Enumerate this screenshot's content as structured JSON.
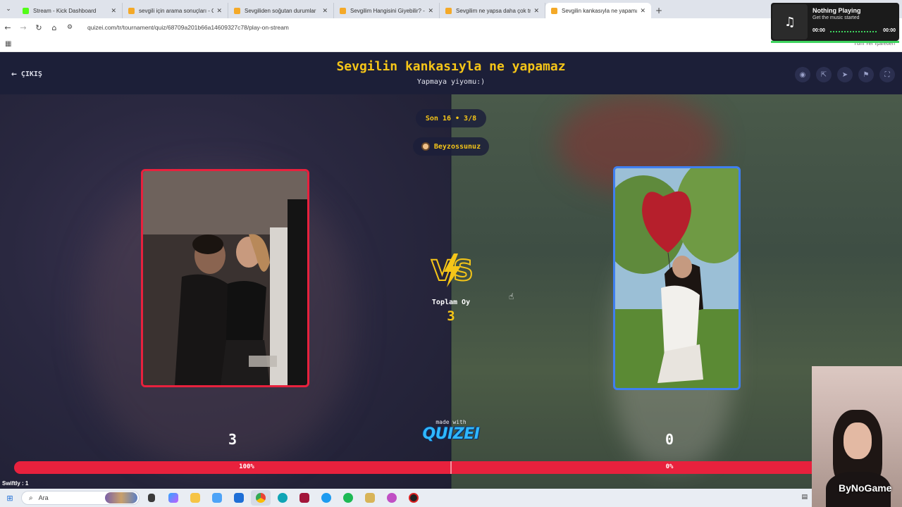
{
  "browser": {
    "tabs": [
      {
        "label": "Stream - Kick Dashboard",
        "color": "#53fc18",
        "active": false
      },
      {
        "label": "sevgili için arama sonuçları - Qu",
        "color": "#f4a928",
        "active": false
      },
      {
        "label": "Sevgiliden soğutan durumlar",
        "color": "#f4a928",
        "active": false
      },
      {
        "label": "Sevgilim Hangisini Giyebilir? - T",
        "color": "#f4a928",
        "active": false
      },
      {
        "label": "Sevgilim ne yapsa daha çok tri",
        "color": "#f4a928",
        "active": false
      },
      {
        "label": "Sevgilin kankasıyla ne yapamaz",
        "color": "#f4a928",
        "active": true
      }
    ],
    "url": "quizei.com/tr/tournament/quiz/68709a201b66a14609327c78/play-on-stream",
    "all_bookmarks": "Tüm Yer İşaretleri"
  },
  "header": {
    "back_label": "ÇIKIŞ",
    "title": "Sevgilin kankasıyla ne yapamaz",
    "subtitle": "Yapmaya yiyomu:)",
    "icons": [
      "eye-icon",
      "share-icon",
      "send-icon",
      "flag-icon",
      "fullscreen-icon"
    ]
  },
  "match": {
    "round": "Son 16 • 3/8",
    "streamer": "Beyzossunuz",
    "total_label": "Toplam Oy",
    "total_value": "3",
    "left": {
      "votes": "3",
      "percent_label": "100%",
      "fraction": 1.0
    },
    "right": {
      "votes": "0",
      "percent_label": "0%",
      "fraction": 0.0
    }
  },
  "branding": {
    "made_with": "made with",
    "logo": "QUIZEI"
  },
  "overlay": {
    "chat_user": "Swiftly : 1",
    "watermark": "ByNoGame"
  },
  "music": {
    "title": "Nothing Playing",
    "subtitle": "Get the music started",
    "time_start": "00:00",
    "time_end": "00:00"
  },
  "taskbar": {
    "search_placeholder": "Ara"
  },
  "colors": {
    "accent_yellow": "#f5c518",
    "vote_red": "#e8213d",
    "right_border_blue": "#3f7ff0",
    "header_bg": "#1c1f38"
  }
}
